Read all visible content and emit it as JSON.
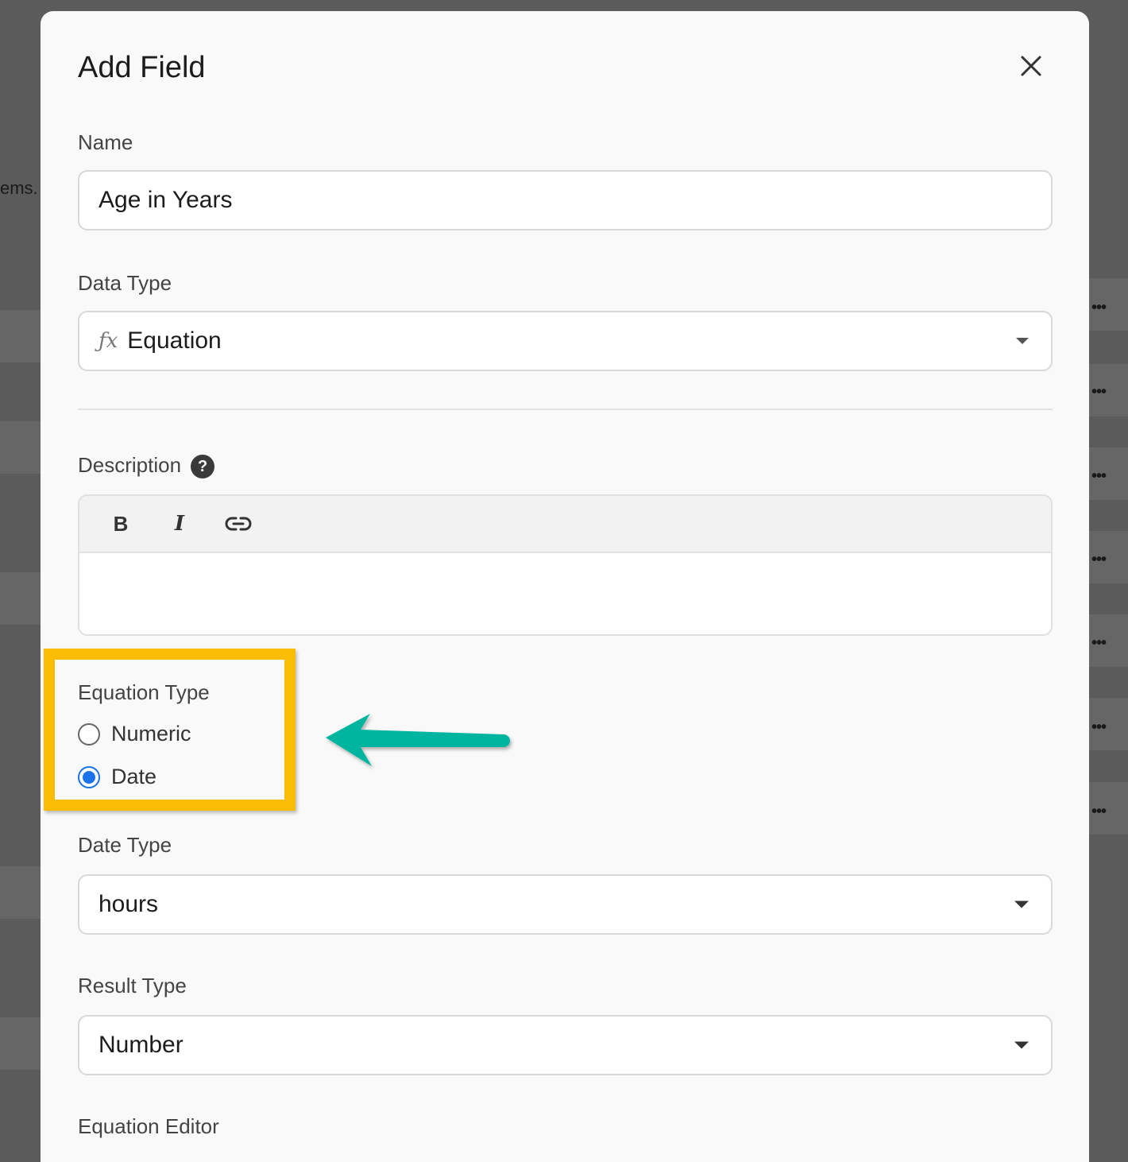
{
  "background": {
    "fragment": "ems.",
    "menu_dots": "•••"
  },
  "modal": {
    "title": "Add Field",
    "name": {
      "label": "Name",
      "value": "Age in Years"
    },
    "data_type": {
      "label": "Data Type",
      "value": "Equation",
      "icon": "function-icon"
    },
    "description": {
      "label": "Description",
      "help": "?",
      "toolbar": {
        "bold": "B",
        "italic": "I"
      }
    },
    "equation_type": {
      "label": "Equation Type",
      "options": [
        {
          "label": "Numeric",
          "checked": false
        },
        {
          "label": "Date",
          "checked": true
        }
      ]
    },
    "date_type": {
      "label": "Date Type",
      "value": "hours"
    },
    "result_type": {
      "label": "Result Type",
      "value": "Number"
    },
    "equation_editor": {
      "label": "Equation Editor"
    }
  },
  "colors": {
    "highlight": "#fbbc05",
    "arrow": "#00b5a0",
    "radio_checked": "#1a73e8"
  }
}
